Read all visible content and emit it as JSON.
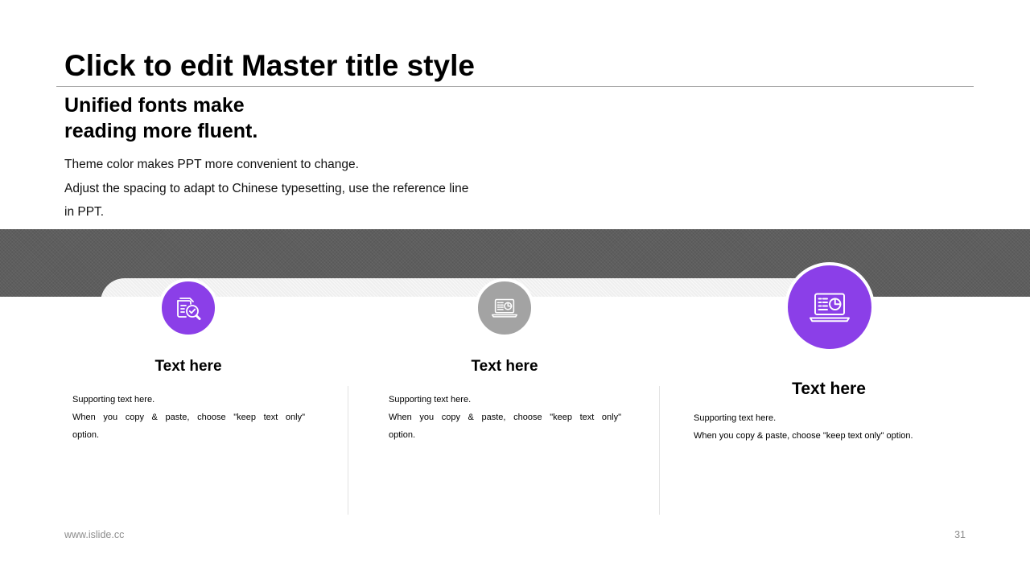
{
  "slide": {
    "title": "Click to edit Master title style",
    "subtitle_line1": "Unified fonts make",
    "subtitle_line2": "reading more fluent.",
    "body_line1": "Theme color makes PPT more convenient to change.",
    "body_line2": "Adjust the spacing to adapt to Chinese typesetting, use the reference line",
    "body_line3": "in PPT."
  },
  "columns": [
    {
      "icon": "document-search-check-icon",
      "title": "Text here",
      "line1": "Supporting text here.",
      "line2": "When you copy & paste, choose \"keep text only\"",
      "line3": "option."
    },
    {
      "icon": "laptop-chart-icon",
      "title": "Text here",
      "line1": "Supporting text here.",
      "line2": "When you copy & paste, choose \"keep text only\"",
      "line3": "option."
    },
    {
      "icon": "laptop-chart-icon",
      "title": "Text here",
      "line1": "Supporting text here.",
      "line2": "When you copy & paste, choose \"keep text only\" option."
    }
  ],
  "colors": {
    "accent": "#8b3fe8",
    "inactive": "#a3a3a3",
    "band": "#5e5e5e"
  },
  "footer": {
    "website": "www.islide.cc",
    "page_number": "31"
  }
}
